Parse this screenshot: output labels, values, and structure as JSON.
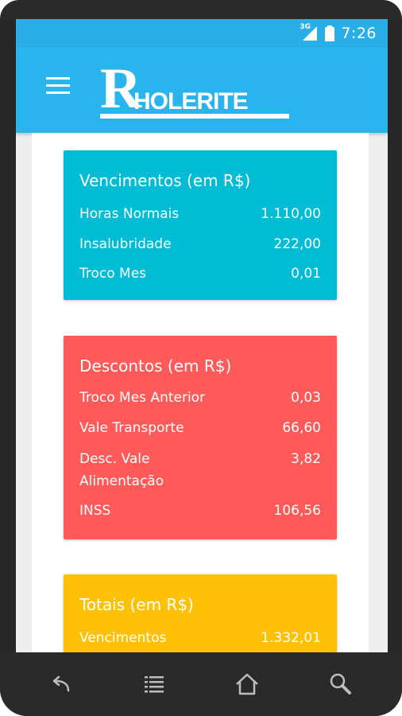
{
  "status_bar": {
    "network": "3G",
    "time": "7:26"
  },
  "app_bar": {
    "logo_text": "RHolerite"
  },
  "cards": {
    "vencimentos": {
      "title": "Vencimentos (em R$)",
      "rows": [
        {
          "label": "Horas Normais",
          "value": "1.110,00"
        },
        {
          "label": "Insalubridade",
          "value": "222,00"
        },
        {
          "label": "Troco Mes",
          "value": "0,01"
        }
      ]
    },
    "descontos": {
      "title": "Descontos (em R$)",
      "rows": [
        {
          "label": "Troco Mes Anterior",
          "value": "0,03"
        },
        {
          "label": "Vale Transporte",
          "value": "66,60"
        },
        {
          "label_line1": "Desc. Vale",
          "label_line2": "Alimentação",
          "value": "3,82"
        },
        {
          "label": "INSS",
          "value": "106,56"
        }
      ]
    },
    "totais": {
      "title": "Totais (em R$)",
      "rows": [
        {
          "label": "Vencimentos",
          "value": "1.332,01"
        }
      ]
    }
  },
  "colors": {
    "status_bar": "#29aee8",
    "app_bar": "#2ab4ee",
    "card_vencimentos": "#00bcd4",
    "card_descontos": "#ff5a5a",
    "card_totais": "#ffc107"
  },
  "navigation": {
    "icons": [
      "back-icon",
      "menu-list-icon",
      "home-icon",
      "search-icon"
    ]
  }
}
